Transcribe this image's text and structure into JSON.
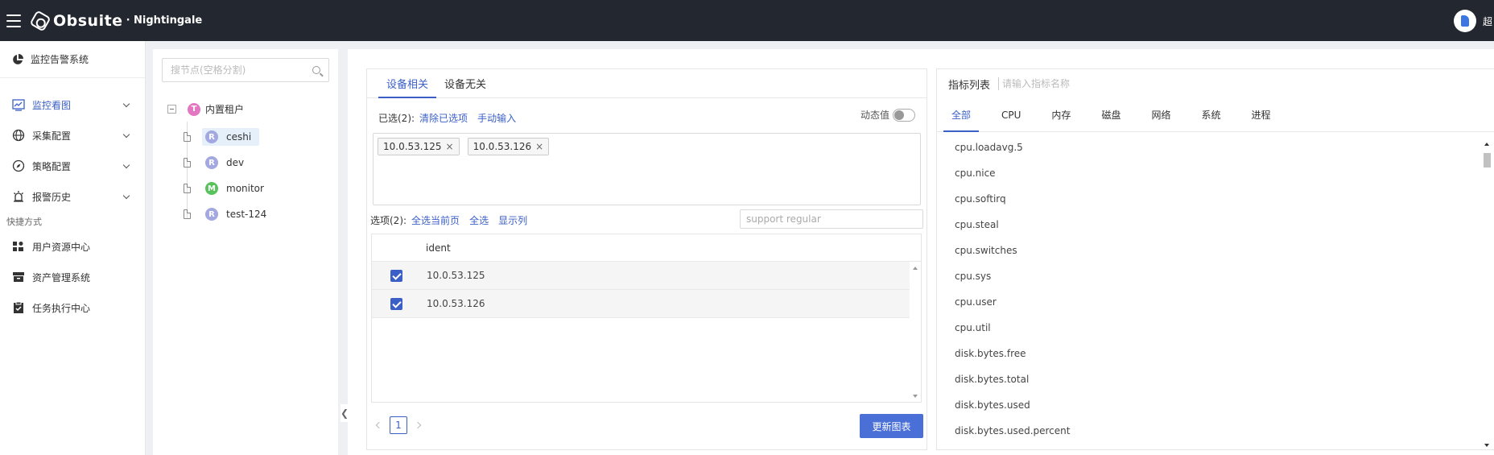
{
  "topbar": {
    "brand": "Obsuite",
    "brand_sub": "· Nightingale",
    "user_name": "超"
  },
  "sidebar": {
    "system": "监控告警系统",
    "items": [
      {
        "label": "监控看图",
        "icon": "chart-icon",
        "active": true
      },
      {
        "label": "采集配置",
        "icon": "globe-icon"
      },
      {
        "label": "策略配置",
        "icon": "compass-icon"
      },
      {
        "label": "报警历史",
        "icon": "alarm-icon"
      }
    ],
    "shortcut_title": "快捷方式",
    "shortcuts": [
      {
        "label": "用户资源中心",
        "icon": "users-icon"
      },
      {
        "label": "资产管理系统",
        "icon": "archive-icon"
      },
      {
        "label": "任务执行中心",
        "icon": "clipboard-icon"
      }
    ]
  },
  "tree": {
    "search_placeholder": "搜节点(空格分割)",
    "root": {
      "badge": "T",
      "label": "内置租户"
    },
    "children": [
      {
        "badge": "R",
        "label": "ceshi",
        "selected": true
      },
      {
        "badge": "R",
        "label": "dev"
      },
      {
        "badge": "M",
        "label": "monitor"
      },
      {
        "badge": "R",
        "label": "test-124"
      }
    ]
  },
  "left": {
    "tabs": [
      "设备相关",
      "设备无关"
    ],
    "selected_label": "已选(2):",
    "clear_selected": "清除已选项",
    "manual_input": "手动输入",
    "dynamic_label": "动态值",
    "chips": [
      "10.0.53.125",
      "10.0.53.126"
    ],
    "options_label": "选项(2):",
    "select_page": "全选当前页",
    "select_all": "全选",
    "show_columns": "显示列",
    "regex_placeholder": "support regular",
    "column_header": "ident",
    "rows": [
      "10.0.53.125",
      "10.0.53.126"
    ],
    "page": "1",
    "update_button": "更新图表"
  },
  "right": {
    "title": "指标列表",
    "search_placeholder": "请输入指标名称",
    "tabs": [
      "全部",
      "CPU",
      "内存",
      "磁盘",
      "网络",
      "系统",
      "进程"
    ],
    "metrics": [
      "cpu.loadavg.5",
      "cpu.nice",
      "cpu.softirq",
      "cpu.steal",
      "cpu.switches",
      "cpu.sys",
      "cpu.user",
      "cpu.util",
      "disk.bytes.free",
      "disk.bytes.total",
      "disk.bytes.used",
      "disk.bytes.used.percent"
    ]
  }
}
